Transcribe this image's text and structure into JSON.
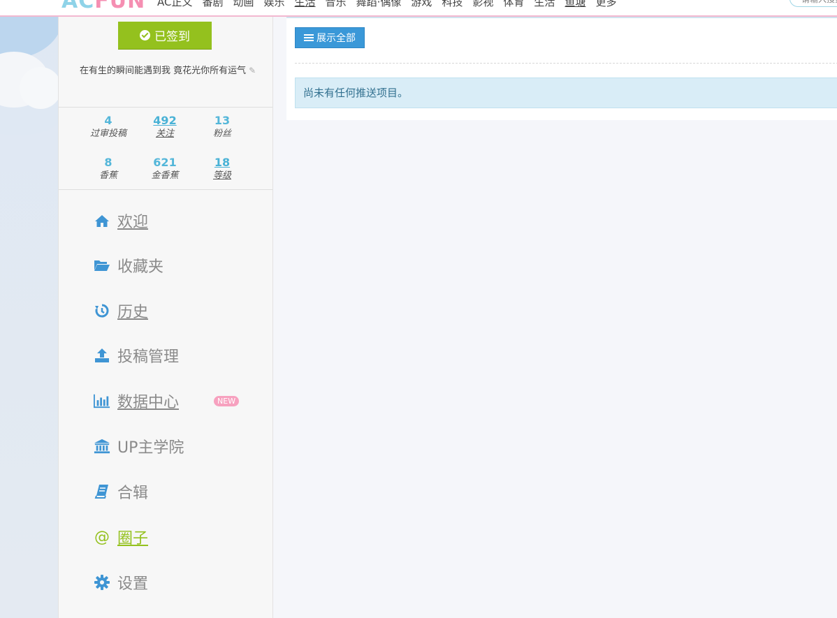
{
  "topnav": {
    "logo_a": "AC",
    "logo_b": "FUN",
    "links": [
      "AC正义",
      "番剧",
      "动画",
      "娱乐",
      "生活",
      "音乐",
      "舞蹈·偶像",
      "游戏",
      "科技",
      "影视",
      "体育",
      "生活",
      "鱼塘",
      "更多"
    ],
    "active_index": 4,
    "search_placeholder": "请输入搜索"
  },
  "sidebar": {
    "signin_label": "已签到",
    "motto": "在有生的瞬间能遇到我 竟花光你所有运气",
    "stats": [
      {
        "num": "4",
        "label": "过审投稿",
        "link": false
      },
      {
        "num": "492",
        "label": "关注",
        "link": true
      },
      {
        "num": "13",
        "label": "粉丝",
        "link": false
      },
      {
        "num": "8",
        "label": "香蕉",
        "link": false
      },
      {
        "num": "621",
        "label": "金香蕉",
        "link": false
      },
      {
        "num": "18",
        "label": "等级",
        "link": true
      }
    ],
    "menu": [
      {
        "label": "欢迎",
        "icon": "home-icon",
        "underline": true
      },
      {
        "label": "收藏夹",
        "icon": "folder-open-icon",
        "underline": false
      },
      {
        "label": "历史",
        "icon": "history-icon",
        "underline": true
      },
      {
        "label": "投稿管理",
        "icon": "upload-icon",
        "underline": false
      },
      {
        "label": "数据中心",
        "icon": "bar-chart-icon",
        "underline": true,
        "badge": "NEW"
      },
      {
        "label": "UP主学院",
        "icon": "institution-icon",
        "underline": false
      },
      {
        "label": "合辑",
        "icon": "book-icon",
        "underline": false
      },
      {
        "label": "圈子",
        "icon": "at-icon",
        "underline": true,
        "active": true
      },
      {
        "label": "设置",
        "icon": "gear-icon",
        "underline": false
      }
    ]
  },
  "main": {
    "show_all_label": "展示全部",
    "notice": "尚未有任何推送项目。"
  },
  "colors": {
    "accent_green": "#94c11e",
    "accent_blue": "#3a98d8",
    "stat_blue": "#53b6d9",
    "badge_pink": "#f7a1bf"
  }
}
